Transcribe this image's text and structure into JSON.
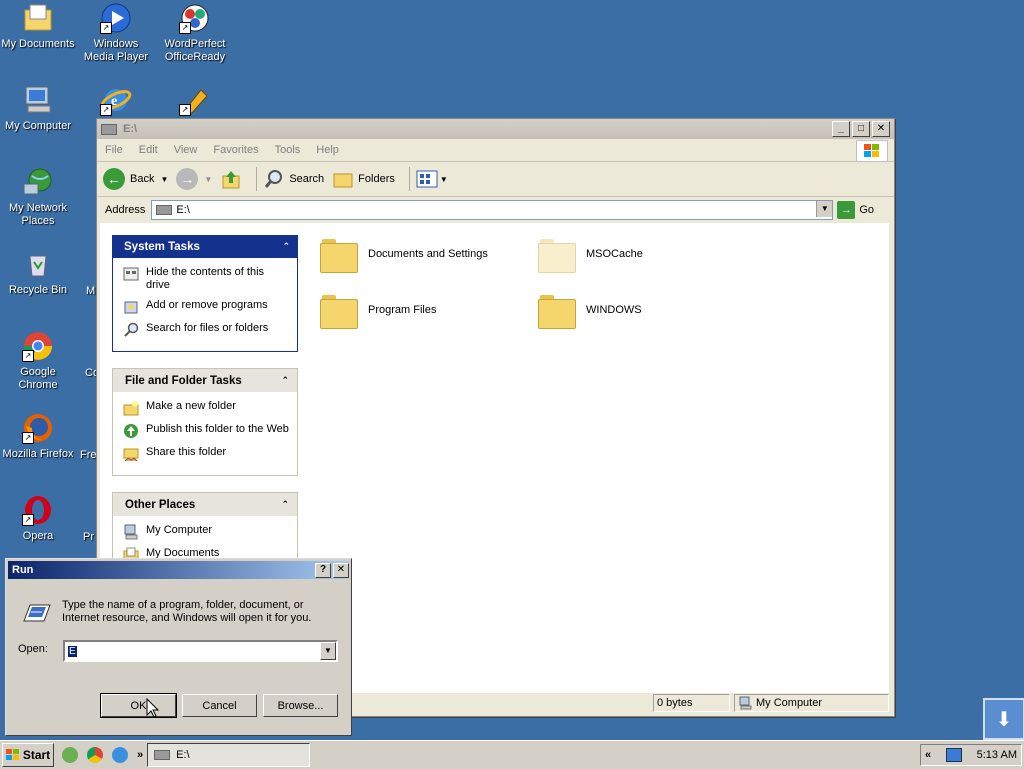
{
  "desktop": {
    "icons": [
      {
        "label": "My Documents"
      },
      {
        "label": "Windows Media Player"
      },
      {
        "label": "WordPerfect OfficeReady"
      },
      {
        "label": "My Computer"
      },
      {
        "label": "My Network Places"
      },
      {
        "label": "Recycle Bin"
      },
      {
        "label": "Google Chrome"
      },
      {
        "label": "Mozilla Firefox"
      },
      {
        "label": "Opera"
      }
    ],
    "partial_labels": [
      "M",
      "Co",
      "Fre",
      "Pr"
    ]
  },
  "explorer": {
    "title": "E:\\",
    "menu": [
      "File",
      "Edit",
      "View",
      "Favorites",
      "Tools",
      "Help"
    ],
    "toolbar": {
      "back": "Back",
      "search": "Search",
      "folders": "Folders"
    },
    "address": {
      "label": "Address",
      "value": "E:\\",
      "go": "Go"
    },
    "system_tasks": {
      "title": "System Tasks",
      "items": [
        "Hide the contents of this drive",
        "Add or remove programs",
        "Search for files or folders"
      ]
    },
    "file_tasks": {
      "title": "File and Folder Tasks",
      "items": [
        "Make a new folder",
        "Publish this folder to the Web",
        "Share this folder"
      ]
    },
    "other_places": {
      "title": "Other Places",
      "items": [
        "My Computer",
        "My Documents"
      ]
    },
    "folders": [
      "Documents and Settings",
      "MSOCache",
      "Program Files",
      "WINDOWS"
    ],
    "status": {
      "size": "0 bytes",
      "location": "My Computer"
    }
  },
  "run_dialog": {
    "title": "Run",
    "description": "Type the name of a program, folder, document, or Internet resource, and Windows will open it for you.",
    "open_label": "Open:",
    "open_value": "E",
    "ok": "OK",
    "cancel": "Cancel",
    "browse": "Browse..."
  },
  "taskbar": {
    "start": "Start",
    "window_button": "E:\\",
    "clock": "5:13 AM",
    "chevron": "»",
    "tray_arrow": "«"
  },
  "colors": {
    "desktop": "#3a6ea5",
    "accent": "#14318d",
    "folder": "#f4d66c"
  }
}
